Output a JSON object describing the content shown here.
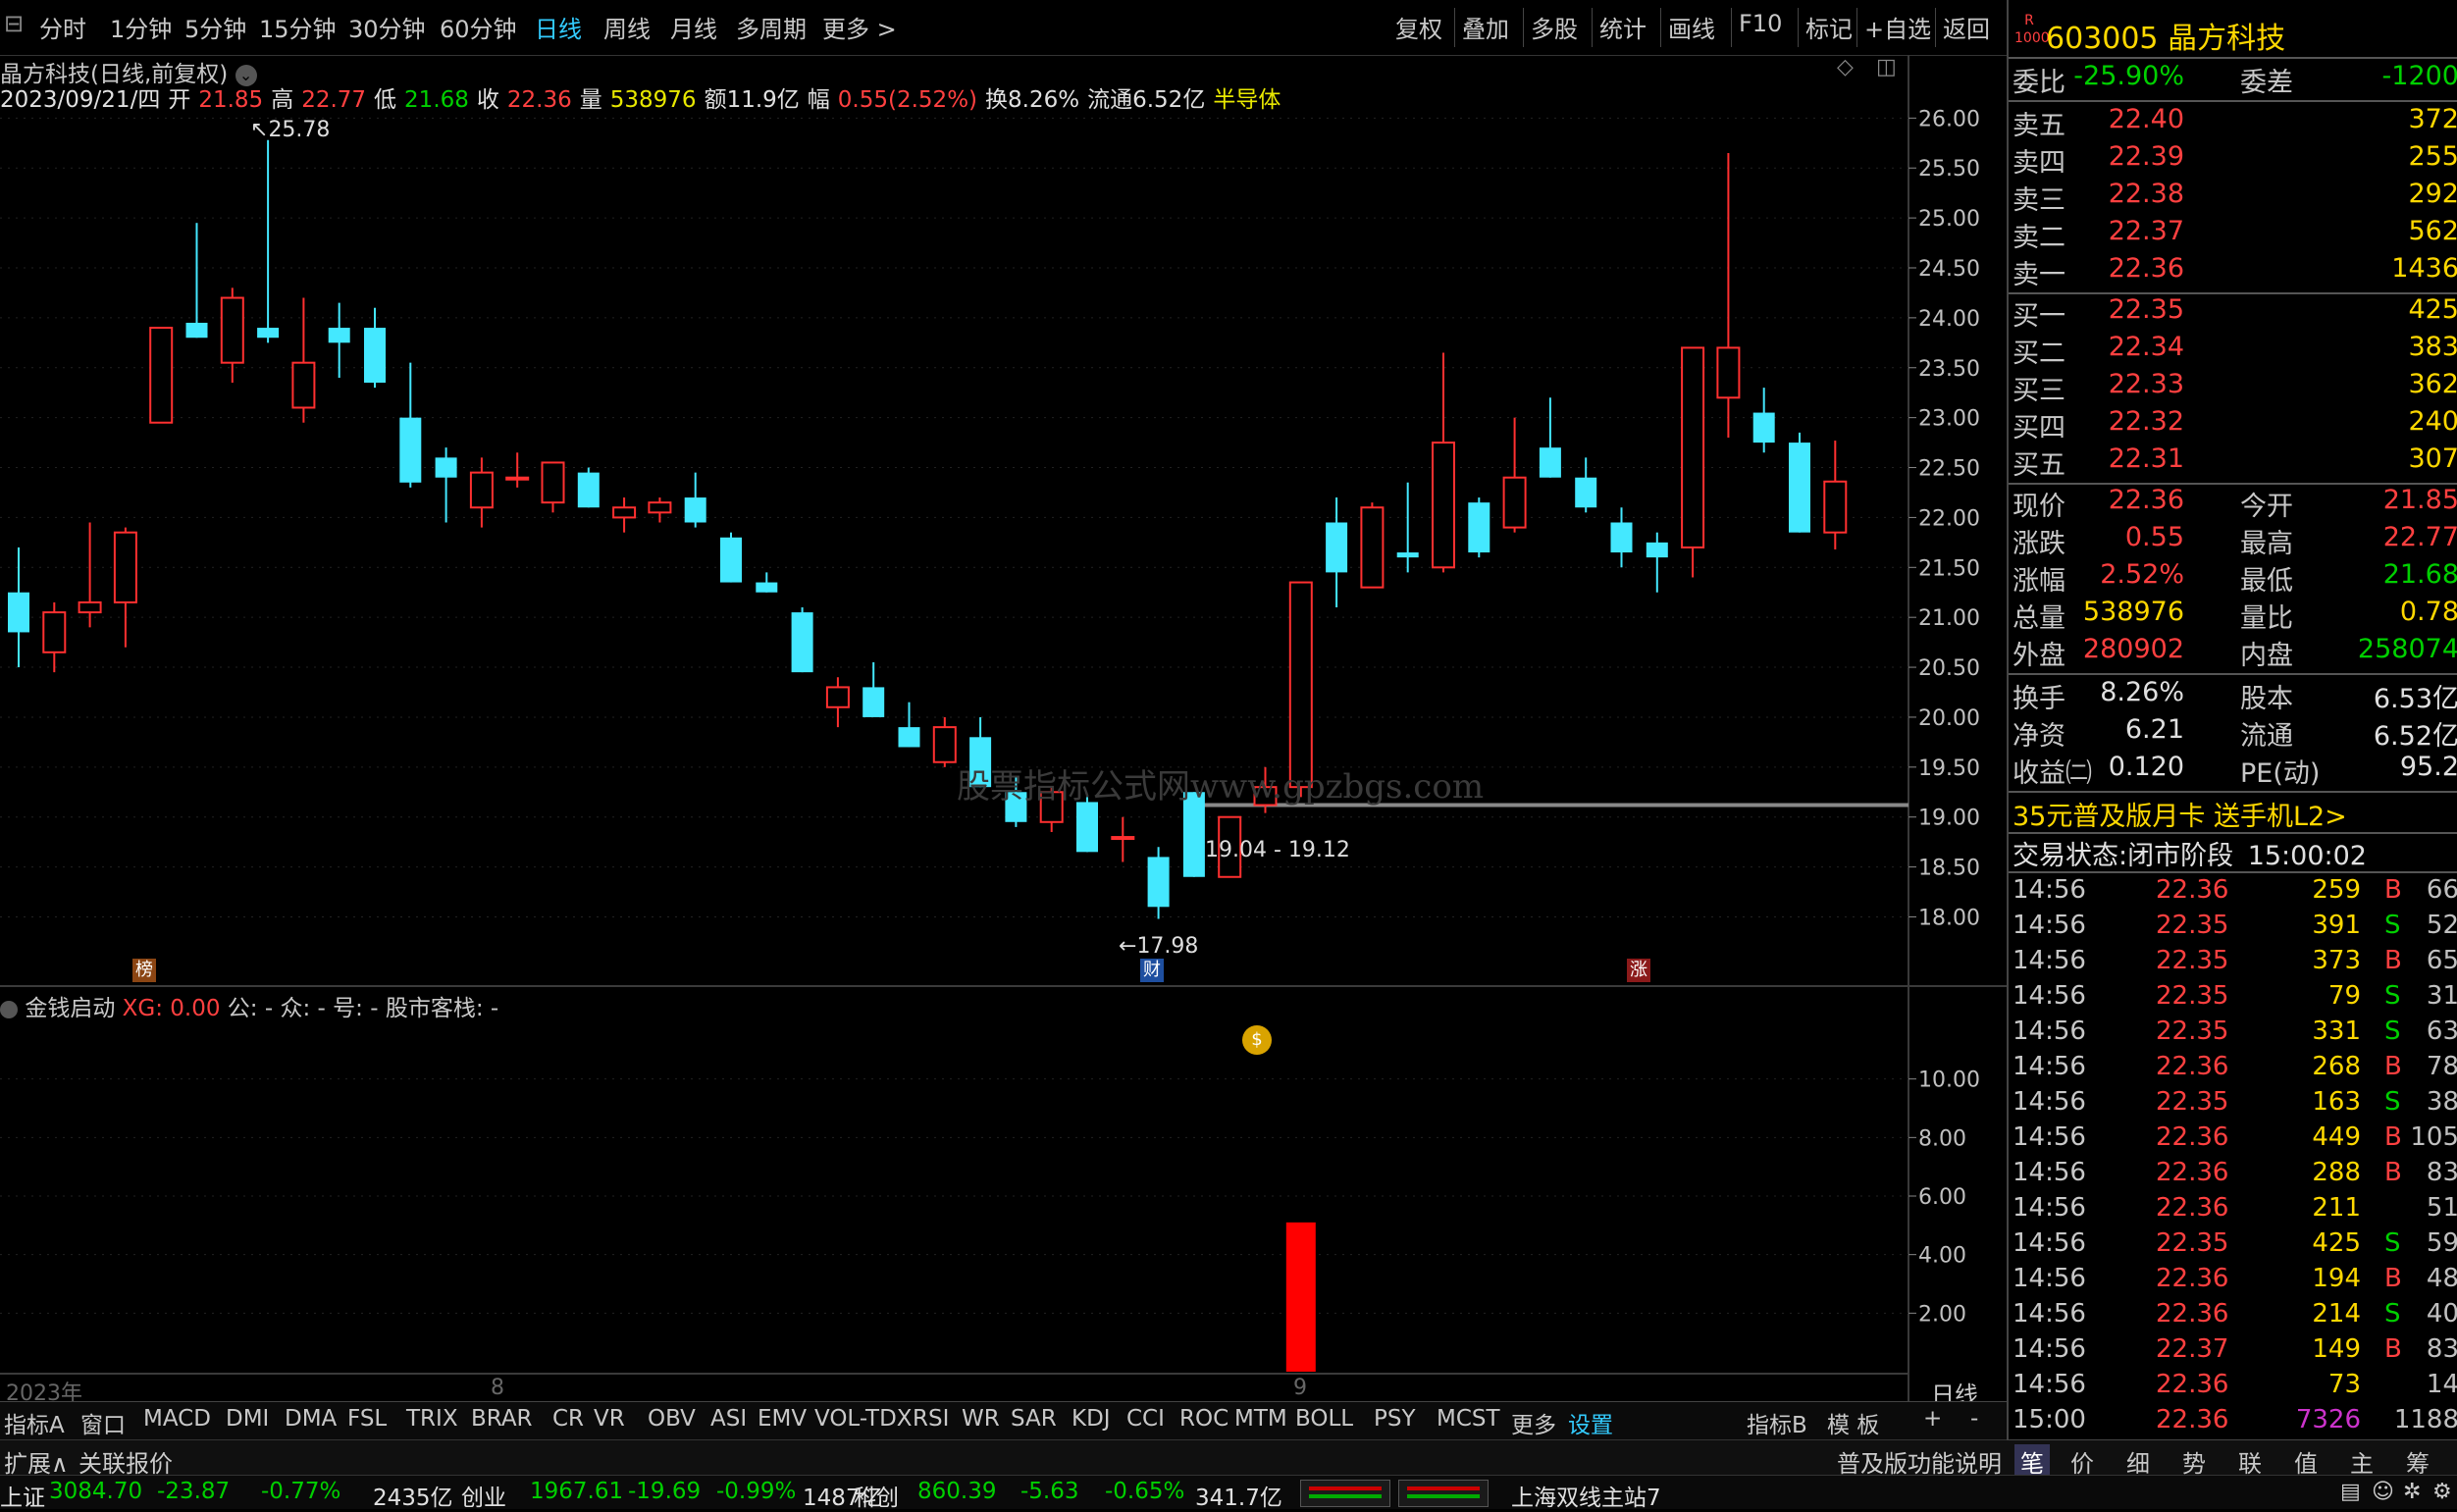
{
  "toolbar": {
    "tabs": [
      "分时",
      "1分钟",
      "5分钟",
      "15分钟",
      "30分钟",
      "60分钟",
      "日线",
      "周线",
      "月线",
      "多周期",
      "更多 >"
    ],
    "active_tab": "日线",
    "right_buttons": [
      "复权",
      "叠加",
      "多股",
      "统计",
      "画线",
      "F10",
      "标记",
      "+自选",
      "返回"
    ]
  },
  "chart_header": {
    "title": "晶方科技(日线,前复权)",
    "date": "2023/09/21/四",
    "open_label": "开",
    "open": "21.85",
    "high_label": "高",
    "high": "22.77",
    "low_label": "低",
    "low": "21.68",
    "close_label": "收",
    "close": "22.36",
    "vol_label": "量",
    "vol": "538976",
    "amount": "额11.9亿",
    "change_label": "幅",
    "change": "0.55(2.52%)",
    "turnover": "换8.26%",
    "float": "流通6.52亿",
    "sector": "半导体"
  },
  "annotations": {
    "high_mark": "25.78",
    "low_mark": "17.98",
    "range_label": "19.04 - 19.12",
    "watermark": "股票指标公式网www.gpzbgs.com",
    "badge_bang": "榜",
    "badge_cai": "财",
    "badge_zhang": "涨",
    "month_label_1": "2023年",
    "month_label_2": "8",
    "month_label_3": "9",
    "period_label": "日线"
  },
  "indicator_header": {
    "name": "金钱启动",
    "xg": "XG: 0.00",
    "gong": "公: -",
    "zhong": "众: -",
    "hao": "号: -",
    "kezhan": "股市客栈: -"
  },
  "chart_data": [
    {
      "type": "candlestick",
      "title": "",
      "ylim": [
        17.7,
        26.2
      ],
      "yticks": [
        "26.00",
        "25.50",
        "25.00",
        "24.50",
        "24.00",
        "23.50",
        "23.00",
        "22.50",
        "22.00",
        "21.50",
        "21.00",
        "20.50",
        "20.00",
        "19.50",
        "19.00",
        "18.50",
        "18.00"
      ],
      "candles": [
        {
          "o": 21.25,
          "h": 21.7,
          "l": 20.5,
          "c": 20.85
        },
        {
          "o": 20.65,
          "h": 21.15,
          "l": 20.45,
          "c": 21.05
        },
        {
          "o": 21.05,
          "h": 21.95,
          "l": 20.9,
          "c": 21.15
        },
        {
          "o": 21.15,
          "h": 21.9,
          "l": 20.7,
          "c": 21.85
        },
        {
          "o": 22.95,
          "h": 23.9,
          "l": 22.95,
          "c": 23.9
        },
        {
          "o": 23.95,
          "h": 24.95,
          "l": 23.8,
          "c": 23.8
        },
        {
          "o": 23.55,
          "h": 24.3,
          "l": 23.35,
          "c": 24.2
        },
        {
          "o": 23.9,
          "h": 25.78,
          "l": 23.75,
          "c": 23.8
        },
        {
          "o": 23.1,
          "h": 24.2,
          "l": 22.95,
          "c": 23.55
        },
        {
          "o": 23.9,
          "h": 24.15,
          "l": 23.4,
          "c": 23.75
        },
        {
          "o": 23.9,
          "h": 24.1,
          "l": 23.3,
          "c": 23.35
        },
        {
          "o": 23.0,
          "h": 23.55,
          "l": 22.3,
          "c": 22.35
        },
        {
          "o": 22.6,
          "h": 22.7,
          "l": 21.95,
          "c": 22.4
        },
        {
          "o": 22.1,
          "h": 22.6,
          "l": 21.9,
          "c": 22.45
        },
        {
          "o": 22.4,
          "h": 22.65,
          "l": 22.3,
          "c": 22.4
        },
        {
          "o": 22.15,
          "h": 22.55,
          "l": 22.05,
          "c": 22.55
        },
        {
          "o": 22.45,
          "h": 22.5,
          "l": 22.1,
          "c": 22.1
        },
        {
          "o": 22.0,
          "h": 22.2,
          "l": 21.85,
          "c": 22.1
        },
        {
          "o": 22.05,
          "h": 22.2,
          "l": 21.95,
          "c": 22.15
        },
        {
          "o": 22.2,
          "h": 22.45,
          "l": 21.9,
          "c": 21.95
        },
        {
          "o": 21.8,
          "h": 21.85,
          "l": 21.35,
          "c": 21.35
        },
        {
          "o": 21.35,
          "h": 21.45,
          "l": 21.25,
          "c": 21.25
        },
        {
          "o": 21.05,
          "h": 21.1,
          "l": 20.45,
          "c": 20.45
        },
        {
          "o": 20.1,
          "h": 20.4,
          "l": 19.9,
          "c": 20.3
        },
        {
          "o": 20.3,
          "h": 20.55,
          "l": 20.15,
          "c": 20.0
        },
        {
          "o": 19.9,
          "h": 20.15,
          "l": 19.7,
          "c": 19.7
        },
        {
          "o": 19.55,
          "h": 20.0,
          "l": 19.5,
          "c": 19.9
        },
        {
          "o": 19.8,
          "h": 20.0,
          "l": 19.3,
          "c": 19.3
        },
        {
          "o": 19.25,
          "h": 19.4,
          "l": 18.9,
          "c": 18.95
        },
        {
          "o": 18.95,
          "h": 19.3,
          "l": 18.85,
          "c": 19.25
        },
        {
          "o": 19.15,
          "h": 19.2,
          "l": 18.65,
          "c": 18.65
        },
        {
          "o": 18.8,
          "h": 19.0,
          "l": 18.55,
          "c": 18.8
        },
        {
          "o": 18.6,
          "h": 18.7,
          "l": 17.98,
          "c": 18.1
        },
        {
          "o": 19.25,
          "h": 19.25,
          "l": 18.4,
          "c": 18.4
        },
        {
          "o": 18.4,
          "h": 19.0,
          "l": 18.4,
          "c": 19.0
        },
        {
          "o": 19.12,
          "h": 19.5,
          "l": 19.04,
          "c": 19.3
        },
        {
          "o": 19.3,
          "h": 21.35,
          "l": 19.2,
          "c": 21.35
        },
        {
          "o": 21.95,
          "h": 22.2,
          "l": 21.1,
          "c": 21.45
        },
        {
          "o": 21.3,
          "h": 22.15,
          "l": 21.3,
          "c": 22.1
        },
        {
          "o": 21.65,
          "h": 22.35,
          "l": 21.45,
          "c": 21.6
        },
        {
          "o": 21.5,
          "h": 23.65,
          "l": 21.45,
          "c": 22.75
        },
        {
          "o": 22.15,
          "h": 22.2,
          "l": 21.6,
          "c": 21.65
        },
        {
          "o": 21.9,
          "h": 23.0,
          "l": 21.85,
          "c": 22.4
        },
        {
          "o": 22.7,
          "h": 23.2,
          "l": 22.4,
          "c": 22.4
        },
        {
          "o": 22.4,
          "h": 22.6,
          "l": 22.05,
          "c": 22.1
        },
        {
          "o": 21.95,
          "h": 22.1,
          "l": 21.5,
          "c": 21.65
        },
        {
          "o": 21.75,
          "h": 21.85,
          "l": 21.25,
          "c": 21.6
        },
        {
          "o": 21.7,
          "h": 23.7,
          "l": 21.4,
          "c": 23.7
        },
        {
          "o": 23.2,
          "h": 25.65,
          "l": 22.8,
          "c": 23.7
        },
        {
          "o": 23.05,
          "h": 23.3,
          "l": 22.65,
          "c": 22.75
        },
        {
          "o": 22.75,
          "h": 22.85,
          "l": 21.85,
          "c": 21.85
        },
        {
          "o": 21.85,
          "h": 22.77,
          "l": 21.68,
          "c": 22.36
        }
      ],
      "hline": 19.12
    },
    {
      "type": "bar",
      "title": "金钱启动",
      "ylim": [
        0,
        12
      ],
      "yticks": [
        "10.00",
        "8.00",
        "6.00",
        "4.00",
        "2.00"
      ],
      "bars": [
        {
          "index": 36,
          "value": 5.1
        }
      ]
    }
  ],
  "bottom_tabs": [
    "指标A",
    "窗口",
    "MACD",
    "DMI",
    "DMA",
    "FSL",
    "TRIX",
    "BRAR",
    "CR",
    "VR",
    "OBV",
    "ASI",
    "EMV",
    "VOL-TDX",
    "RSI",
    "WR",
    "SAR",
    "KDJ",
    "CCI",
    "ROC",
    "MTM",
    "BOLL",
    "PSY",
    "MCST",
    "更多",
    "设置",
    "指标B",
    "模 板",
    "+",
    "-"
  ],
  "bottom_active": "设置",
  "row2": {
    "expand": "扩展∧",
    "related": "关联报价",
    "right_text": "普及版功能说明"
  },
  "row3": {
    "sh_label": "上证",
    "sh_val": "3084.70",
    "sh_chg": "-23.87",
    "sh_pct": "-0.77%",
    "sh_amt": "2435亿",
    "cy_label": "创业",
    "cy_val": "1967.61",
    "cy_chg": "-19.69",
    "cy_pct": "-0.99%",
    "cy_amt": "1487亿",
    "kc_label": "科创",
    "kc_val": "860.39",
    "kc_chg": "-5.63",
    "kc_pct": "-0.65%",
    "kc_amt": "341.7亿",
    "station": "上海双线主站7"
  },
  "quote": {
    "badge_r": "R",
    "badge_num": "1000",
    "code": "603005",
    "name": "晶方科技",
    "weibi_label": "委比",
    "weibi": "-25.90%",
    "weicha_label": "委差",
    "weicha": "-1200",
    "asks": [
      {
        "label": "卖五",
        "price": "22.40",
        "qty": "372"
      },
      {
        "label": "卖四",
        "price": "22.39",
        "qty": "255"
      },
      {
        "label": "卖三",
        "price": "22.38",
        "qty": "292"
      },
      {
        "label": "卖二",
        "price": "22.37",
        "qty": "562"
      },
      {
        "label": "卖一",
        "price": "22.36",
        "qty": "1436"
      }
    ],
    "bids": [
      {
        "label": "买一",
        "price": "22.35",
        "qty": "425"
      },
      {
        "label": "买二",
        "price": "22.34",
        "qty": "383"
      },
      {
        "label": "买三",
        "price": "22.33",
        "qty": "362"
      },
      {
        "label": "买四",
        "price": "22.32",
        "qty": "240"
      },
      {
        "label": "买五",
        "price": "22.31",
        "qty": "307"
      }
    ],
    "stats": [
      {
        "l1": "现价",
        "v1": "22.36",
        "c1": "#ff4040",
        "l2": "今开",
        "v2": "21.85",
        "c2": "#ff4040"
      },
      {
        "l1": "涨跌",
        "v1": "0.55",
        "c1": "#ff4040",
        "l2": "最高",
        "v2": "22.77",
        "c2": "#ff4040"
      },
      {
        "l1": "涨幅",
        "v1": "2.52%",
        "c1": "#ff4040",
        "l2": "最低",
        "v2": "21.68",
        "c2": "#00d000"
      },
      {
        "l1": "总量",
        "v1": "538976",
        "c1": "#ffd800",
        "l2": "量比",
        "v2": "0.78",
        "c2": "#ffd800"
      },
      {
        "l1": "外盘",
        "v1": "280902",
        "c1": "#ff4040",
        "l2": "内盘",
        "v2": "258074",
        "c2": "#00d000"
      }
    ],
    "stats2": [
      {
        "l1": "换手",
        "v1": "8.26%",
        "l2": "股本",
        "v2": "6.53亿"
      },
      {
        "l1": "净资",
        "v1": "6.21",
        "l2": "流通",
        "v2": "6.52亿"
      },
      {
        "l1": "收益㈡",
        "v1": "0.120",
        "l2": "PE(动)",
        "v2": "95.2"
      }
    ],
    "promo": "35元普及版月卡 送手机L2>",
    "status_label": "交易状态:",
    "status": "闭市阶段",
    "status_time": "15:00:02",
    "ticks": [
      {
        "t": "14:56",
        "p": "22.36",
        "n": "259",
        "d": "B",
        "x": "66"
      },
      {
        "t": "14:56",
        "p": "22.35",
        "n": "391",
        "d": "S",
        "x": "52"
      },
      {
        "t": "14:56",
        "p": "22.35",
        "n": "373",
        "d": "B",
        "x": "65"
      },
      {
        "t": "14:56",
        "p": "22.35",
        "n": "79",
        "d": "S",
        "x": "31"
      },
      {
        "t": "14:56",
        "p": "22.35",
        "n": "331",
        "d": "S",
        "x": "63"
      },
      {
        "t": "14:56",
        "p": "22.36",
        "n": "268",
        "d": "B",
        "x": "78"
      },
      {
        "t": "14:56",
        "p": "22.35",
        "n": "163",
        "d": "S",
        "x": "38"
      },
      {
        "t": "14:56",
        "p": "22.36",
        "n": "449",
        "d": "B",
        "x": "105"
      },
      {
        "t": "14:56",
        "p": "22.36",
        "n": "288",
        "d": "B",
        "x": "83"
      },
      {
        "t": "14:56",
        "p": "22.36",
        "n": "211",
        "d": "",
        "x": "51"
      },
      {
        "t": "14:56",
        "p": "22.35",
        "n": "425",
        "d": "S",
        "x": "59"
      },
      {
        "t": "14:56",
        "p": "22.36",
        "n": "194",
        "d": "B",
        "x": "48"
      },
      {
        "t": "14:56",
        "p": "22.36",
        "n": "214",
        "d": "S",
        "x": "40"
      },
      {
        "t": "14:56",
        "p": "22.37",
        "n": "149",
        "d": "B",
        "x": "83"
      },
      {
        "t": "14:56",
        "p": "22.36",
        "n": "73",
        "d": "",
        "x": "14"
      },
      {
        "t": "15:00",
        "p": "22.36",
        "n": "7326",
        "d": "",
        "x": "1188"
      }
    ],
    "bottom_tabs": [
      "笔",
      "价",
      "细",
      "势",
      "联",
      "值",
      "主",
      "筹"
    ]
  },
  "colors": {
    "up": "#ff3030",
    "down": "#44e8ff",
    "accent": "#33ccff",
    "label": "#ffd800"
  }
}
